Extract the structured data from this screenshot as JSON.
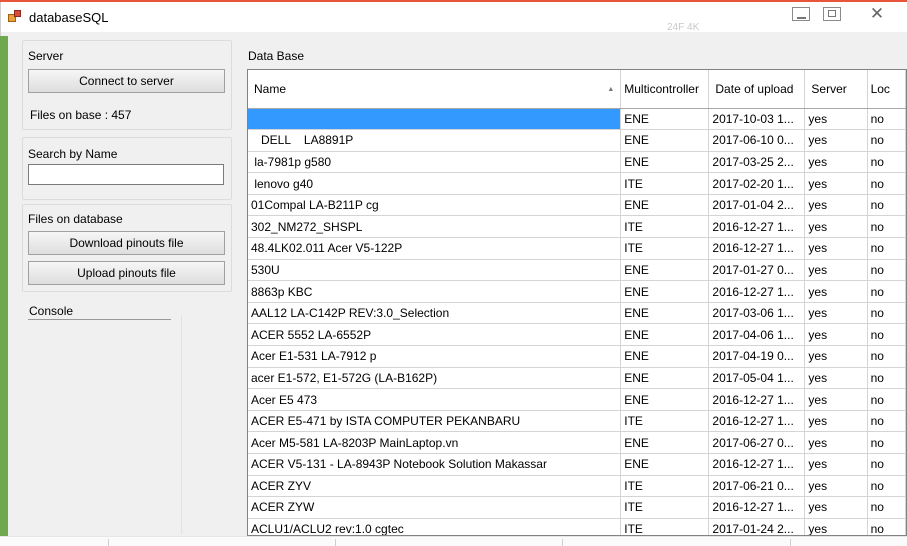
{
  "window": {
    "title": "databaseSQL",
    "ghost_text": "24F 4K"
  },
  "server_group": {
    "label": "Server",
    "connect_button": "Connect to server",
    "files_on_base": "Files on base : 457"
  },
  "search_group": {
    "label": "Search by Name",
    "value": ""
  },
  "files_group": {
    "label": "Files on database",
    "download_button": "Download pinouts file",
    "upload_button": "Upload pinouts file"
  },
  "console": {
    "label": "Console"
  },
  "database": {
    "label": "Data Base",
    "columns": [
      "Name",
      "Multicontroller",
      "Date of upload",
      "Server",
      "Loc"
    ],
    "selected_row": 0,
    "rows": [
      [
        "",
        "ENE",
        "2017-10-03 1...",
        "yes",
        "no"
      ],
      [
        "   DELL    LA8891P",
        "ENE",
        "2017-06-10 0...",
        "yes",
        "no"
      ],
      [
        " la-7981p g580",
        "ENE",
        "2017-03-25 2...",
        "yes",
        "no"
      ],
      [
        " lenovo g40",
        "ITE",
        "2017-02-20 1...",
        "yes",
        "no"
      ],
      [
        "01Compal LA-B211P cg",
        "ENE",
        "2017-01-04 2...",
        "yes",
        "no"
      ],
      [
        "302_NM272_SHSPL",
        "ITE",
        "2016-12-27 1...",
        "yes",
        "no"
      ],
      [
        "48.4LK02.011 Acer V5-122P",
        "ITE",
        "2016-12-27 1...",
        "yes",
        "no"
      ],
      [
        "530U",
        "ENE",
        "2017-01-27 0...",
        "yes",
        "no"
      ],
      [
        "8863p KBC",
        "ENE",
        "2016-12-27 1...",
        "yes",
        "no"
      ],
      [
        "AAL12 LA-C142P REV:3.0_Selection",
        "ENE",
        "2017-03-06 1...",
        "yes",
        "no"
      ],
      [
        "ACER 5552 LA-6552P",
        "ENE",
        "2017-04-06 1...",
        "yes",
        "no"
      ],
      [
        "Acer E1-531 LA-7912 p",
        "ENE",
        "2017-04-19 0...",
        "yes",
        "no"
      ],
      [
        "acer E1-572, E1-572G (LA-B162P)",
        "ENE",
        "2017-05-04 1...",
        "yes",
        "no"
      ],
      [
        "Acer E5 473",
        "ENE",
        "2016-12-27 1...",
        "yes",
        "no"
      ],
      [
        "ACER E5-471 by ISTA COMPUTER PEKANBARU",
        "ITE",
        "2016-12-27 1...",
        "yes",
        "no"
      ],
      [
        "Acer M5-581 LA-8203P MainLaptop.vn",
        "ENE",
        "2017-06-27 0...",
        "yes",
        "no"
      ],
      [
        "ACER V5-131 - LA-8943P Notebook Solution Makassar",
        "ENE",
        "2016-12-27 1...",
        "yes",
        "no"
      ],
      [
        "ACER ZYV",
        "ITE",
        "2017-06-21 0...",
        "yes",
        "no"
      ],
      [
        "ACER ZYW",
        "ITE",
        "2016-12-27 1...",
        "yes",
        "no"
      ],
      [
        "ACLU1/ACLU2 rev:1.0 cgtec",
        "ITE",
        "2017-01-24 2...",
        "yes",
        "no"
      ]
    ]
  }
}
